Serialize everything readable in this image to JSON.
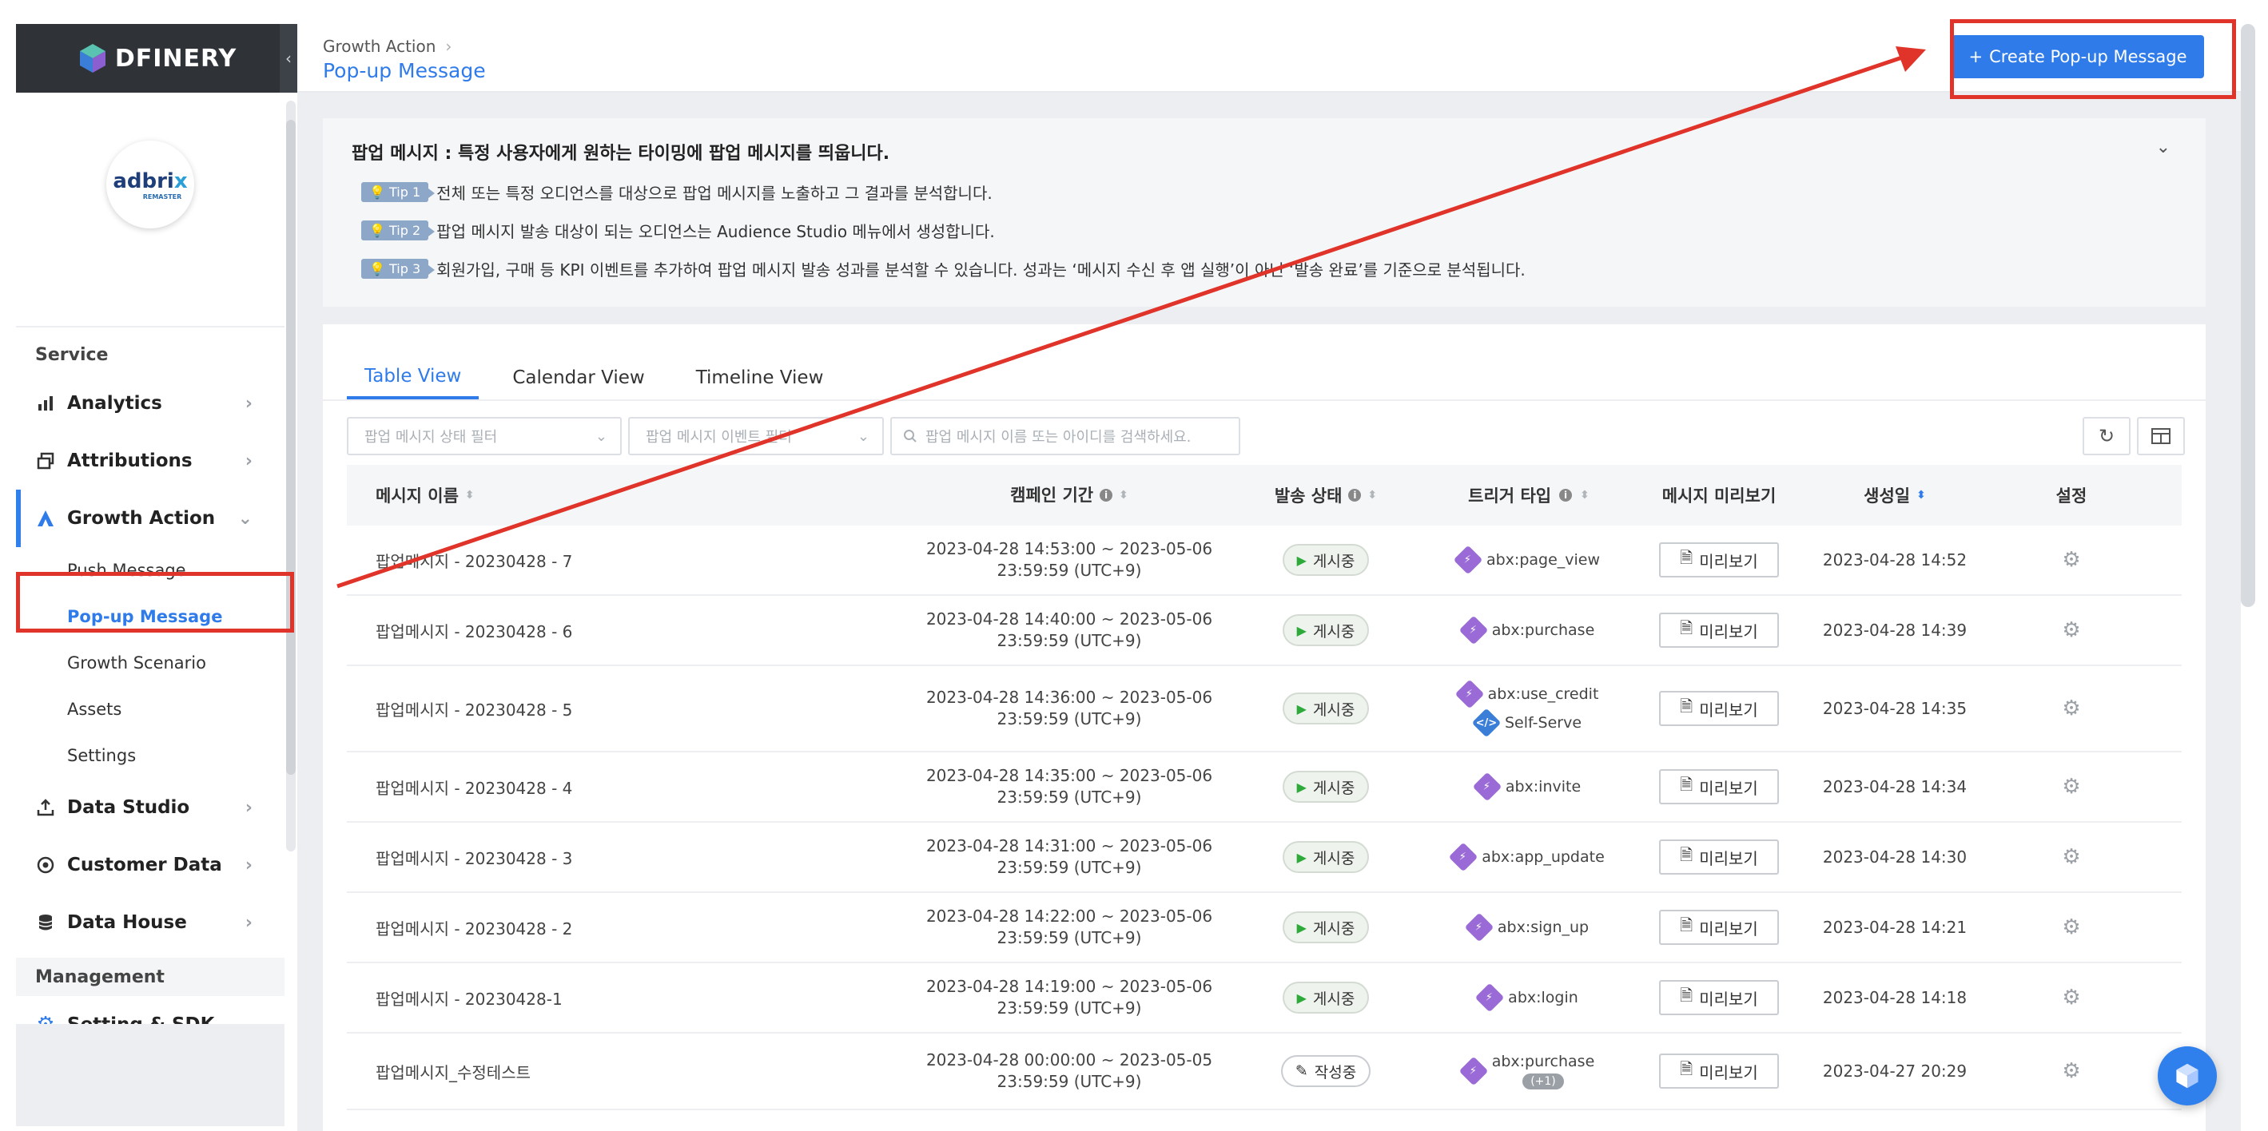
{
  "brand": {
    "name": "DFINERY",
    "accent": "#2f7bea"
  },
  "workspace": {
    "name_main": "adbri",
    "name_accent": "x",
    "name_sub": "REMASTER"
  },
  "sidebar": {
    "service_title": "Service",
    "items": [
      {
        "label": "Analytics",
        "icon": "bar-chart-icon"
      },
      {
        "label": "Attributions",
        "icon": "attribution-icon"
      },
      {
        "label": "Growth Action",
        "icon": "growth-action-icon"
      },
      {
        "label": "Data Studio",
        "icon": "upload-icon"
      },
      {
        "label": "Customer Data",
        "icon": "target-icon"
      },
      {
        "label": "Data House",
        "icon": "database-icon"
      }
    ],
    "growth_sub": [
      "Push Message",
      "Pop-up Message",
      "Growth Scenario",
      "Assets",
      "Settings"
    ],
    "management_title": "Management",
    "setting_sdk": "Setting & SDK"
  },
  "header": {
    "breadcrumb": "Growth Action",
    "title": "Pop-up Message",
    "create_button": "Create Pop-up Message"
  },
  "tips": {
    "title": "팝업 메시지 : 특정 사용자에게 원하는 타이밍에 팝업 메시지를 띄웁니다.",
    "items": [
      {
        "badge": "Tip 1",
        "text": "전체 또는 특정 오디언스를 대상으로 팝업 메시지를 노출하고 그 결과를 분석합니다."
      },
      {
        "badge": "Tip 2",
        "text": "팝업 메시지 발송 대상이 되는 오디언스는 Audience Studio 메뉴에서 생성합니다."
      },
      {
        "badge": "Tip 3",
        "text": "회원가입, 구매 등 KPI 이벤트를 추가하여 팝업 메시지 발송 성과를 분석할 수 있습니다. 성과는 ‘메시지 수신 후 앱 실행’이 아닌 ‘발송 완료’를 기준으로 분석됩니다."
      }
    ]
  },
  "tabs": [
    "Table View",
    "Calendar View",
    "Timeline View"
  ],
  "filters": {
    "status_placeholder": "팝업 메시지 상태 필터",
    "event_placeholder": "팝업 메시지 이벤트 필터",
    "search_placeholder": "팝업 메시지 이름 또는 아이디를 검색하세요."
  },
  "table": {
    "headers": [
      "메시지 이름",
      "캠페인 기간",
      "발송 상태",
      "트리거 타입",
      "메시지 미리보기",
      "생성일",
      "설정"
    ],
    "preview_label": "미리보기",
    "rows": [
      {
        "name": "팝업메시지 - 20230428 - 7",
        "period1": "2023-04-28 14:53:00 ~ 2023-05-06",
        "period2": "23:59:59 (UTC+9)",
        "status": "게시중",
        "triggers": [
          "abx:page_view"
        ],
        "created": "2023-04-28 14:52"
      },
      {
        "name": "팝업메시지 - 20230428 - 6",
        "period1": "2023-04-28 14:40:00 ~ 2023-05-06",
        "period2": "23:59:59 (UTC+9)",
        "status": "게시중",
        "triggers": [
          "abx:purchase"
        ],
        "created": "2023-04-28 14:39"
      },
      {
        "name": "팝업메시지 - 20230428 - 5",
        "period1": "2023-04-28 14:36:00 ~ 2023-05-06",
        "period2": "23:59:59 (UTC+9)",
        "status": "게시중",
        "triggers": [
          "abx:use_credit",
          "Self-Serve"
        ],
        "created": "2023-04-28 14:35"
      },
      {
        "name": "팝업메시지 - 20230428 - 4",
        "period1": "2023-04-28 14:35:00 ~ 2023-05-06",
        "period2": "23:59:59 (UTC+9)",
        "status": "게시중",
        "triggers": [
          "abx:invite"
        ],
        "created": "2023-04-28 14:34"
      },
      {
        "name": "팝업메시지 - 20230428 - 3",
        "period1": "2023-04-28 14:31:00 ~ 2023-05-06",
        "period2": "23:59:59 (UTC+9)",
        "status": "게시중",
        "triggers": [
          "abx:app_update"
        ],
        "created": "2023-04-28 14:30"
      },
      {
        "name": "팝업메시지 - 20230428 - 2",
        "period1": "2023-04-28 14:22:00 ~ 2023-05-06",
        "period2": "23:59:59 (UTC+9)",
        "status": "게시중",
        "triggers": [
          "abx:sign_up"
        ],
        "created": "2023-04-28 14:21"
      },
      {
        "name": "팝업메시지 - 20230428-1",
        "period1": "2023-04-28 14:19:00 ~ 2023-05-06",
        "period2": "23:59:59 (UTC+9)",
        "status": "게시중",
        "triggers": [
          "abx:login"
        ],
        "created": "2023-04-28 14:18"
      },
      {
        "name": "팝업메시지_수정테스트",
        "period1": "2023-04-28 00:00:00 ~ 2023-05-05",
        "period2": "23:59:59 (UTC+9)",
        "status": "작성중",
        "triggers": [
          "abx:purchase"
        ],
        "more": "(+1)",
        "created": "2023-04-27 20:29"
      }
    ]
  },
  "annotation_color": "#e03329"
}
